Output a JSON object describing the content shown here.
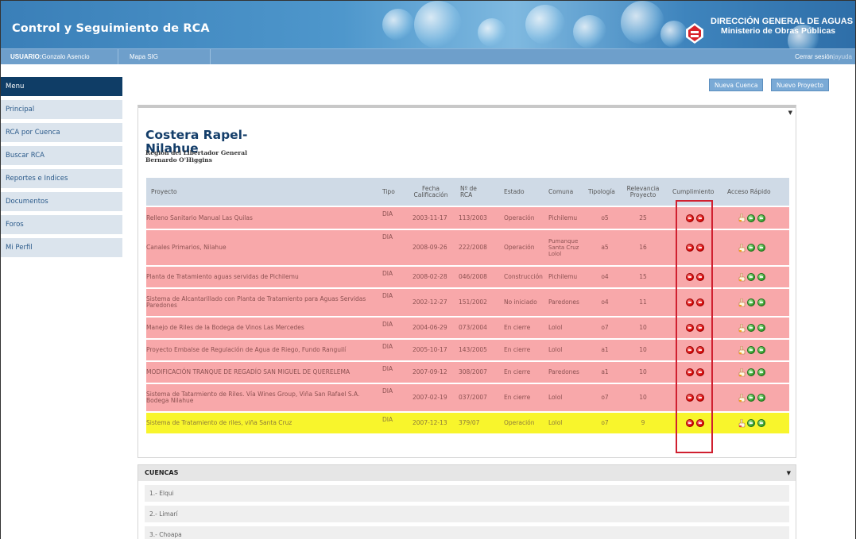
{
  "header": {
    "title": "Control y Seguimiento de RCA",
    "org_name": "DIRECCIÓN GENERAL DE AGUAS",
    "org_sub": "Ministerio de Obras Públicas"
  },
  "userbar": {
    "user_label": "USUARIO:",
    "user_name": "Gonzalo Asencio",
    "map_link": "Mapa SIG",
    "logout": "Cerrar sesión",
    "separator": "|",
    "help": "ayuda"
  },
  "sidebar": {
    "items": [
      {
        "label": "Menu"
      },
      {
        "label": "Principal"
      },
      {
        "label": "RCA por Cuenca"
      },
      {
        "label": "Buscar RCA"
      },
      {
        "label": "Reportes e Indices"
      },
      {
        "label": "Documentos"
      },
      {
        "label": "Foros"
      },
      {
        "label": "Mi Perfil"
      }
    ]
  },
  "buttons": {
    "new_basin": "Nueva Cuenca",
    "new_project": "Nuevo Proyecto"
  },
  "region": {
    "title_line1": "Costera Rapel-",
    "title_line2": "Nilahue",
    "sub_line1": "Región del Libertador General",
    "sub_line2": "Bernardo O'Higgins"
  },
  "table": {
    "headers": {
      "proyecto": "Proyecto",
      "tipo": "Tipo",
      "fecha1": "Fecha",
      "fecha2": "Calificación",
      "nrca1": "Nº de",
      "nrca2": "RCA",
      "estado": "Estado",
      "comuna": "Comuna",
      "tipologia": "Tipología",
      "relev1": "Relevancia",
      "relev2": "Proyecto",
      "cumplimiento": "Cumplimiento",
      "acceso": "Acceso Rápido"
    },
    "rows": [
      {
        "proyecto": "Relleno Sanitario Manual Las Quilas",
        "tipo": "DIA",
        "fecha": "2003-11-17",
        "rca": "113/2003",
        "estado": "Operación",
        "comuna": "Pichilemu",
        "tipologia": "o5",
        "relevancia": "25",
        "color": "red"
      },
      {
        "proyecto": "Canales Primarios, Nilahue",
        "tipo": "DIA",
        "fecha": "2008-09-26",
        "rca": "222/2008",
        "estado": "Operación",
        "comuna": "Pumanque Santa Cruz Lolol",
        "tipologia": "a5",
        "relevancia": "16",
        "color": "red"
      },
      {
        "proyecto": "Planta de Tratamiento aguas servidas de Pichilemu",
        "tipo": "DIA",
        "fecha": "2008-02-28",
        "rca": "046/2008",
        "estado": "Construcción",
        "comuna": "Pichilemu",
        "tipologia": "o4",
        "relevancia": "15",
        "color": "red"
      },
      {
        "proyecto": "Sistema de Alcantarillado con Planta de Tratamiento para Aguas Servidas Paredones",
        "tipo": "DIA",
        "fecha": "2002-12-27",
        "rca": "151/2002",
        "estado": "No iniciado",
        "comuna": "Paredones",
        "tipologia": "o4",
        "relevancia": "11",
        "color": "red"
      },
      {
        "proyecto": "Manejo de Riles de la Bodega de Vinos Las Mercedes",
        "tipo": "DIA",
        "fecha": "2004-06-29",
        "rca": "073/2004",
        "estado": "En cierre",
        "comuna": "Lolol",
        "tipologia": "o7",
        "relevancia": "10",
        "color": "red"
      },
      {
        "proyecto": "Proyecto Embalse de Regulación de Agua de Riego, Fundo Ranguilí",
        "tipo": "DIA",
        "fecha": "2005-10-17",
        "rca": "143/2005",
        "estado": "En cierre",
        "comuna": "Lolol",
        "tipologia": "a1",
        "relevancia": "10",
        "color": "red"
      },
      {
        "proyecto": "MODIFICACIÓN TRANQUE DE REGADÍO SAN MIGUEL DE QUERELEMA",
        "tipo": "DIA",
        "fecha": "2007-09-12",
        "rca": "308/2007",
        "estado": "En cierre",
        "comuna": "Paredones",
        "tipologia": "a1",
        "relevancia": "10",
        "color": "red"
      },
      {
        "proyecto": "Sistema de Tatarmiento de Riles. Vía Wines Group, Viña San Rafael S.A. Bodega Nilahue",
        "tipo": "DIA",
        "fecha": "2007-02-19",
        "rca": "037/2007",
        "estado": "En cierre",
        "comuna": "Lolol",
        "tipologia": "o7",
        "relevancia": "10",
        "color": "red"
      },
      {
        "proyecto": "Sistema de Tratamiento de riles, viña Santa Cruz",
        "tipo": "DIA",
        "fecha": "2007-12-13",
        "rca": "379/07",
        "estado": "Operación",
        "comuna": "Lolol",
        "tipologia": "o7",
        "relevancia": "9",
        "color": "yellow"
      }
    ]
  },
  "cuencas": {
    "title": "CUENCAS",
    "items": [
      {
        "label": "1.- Elqui"
      },
      {
        "label": "2.- Limarí"
      },
      {
        "label": "3.- Choapa"
      }
    ]
  },
  "colors": {
    "header_blue": "#4e97cc",
    "row_red": "#f8a8aa",
    "row_yellow": "#f8f52c",
    "highlight_box": "#d02030",
    "menu_dark": "#0f3d66"
  }
}
